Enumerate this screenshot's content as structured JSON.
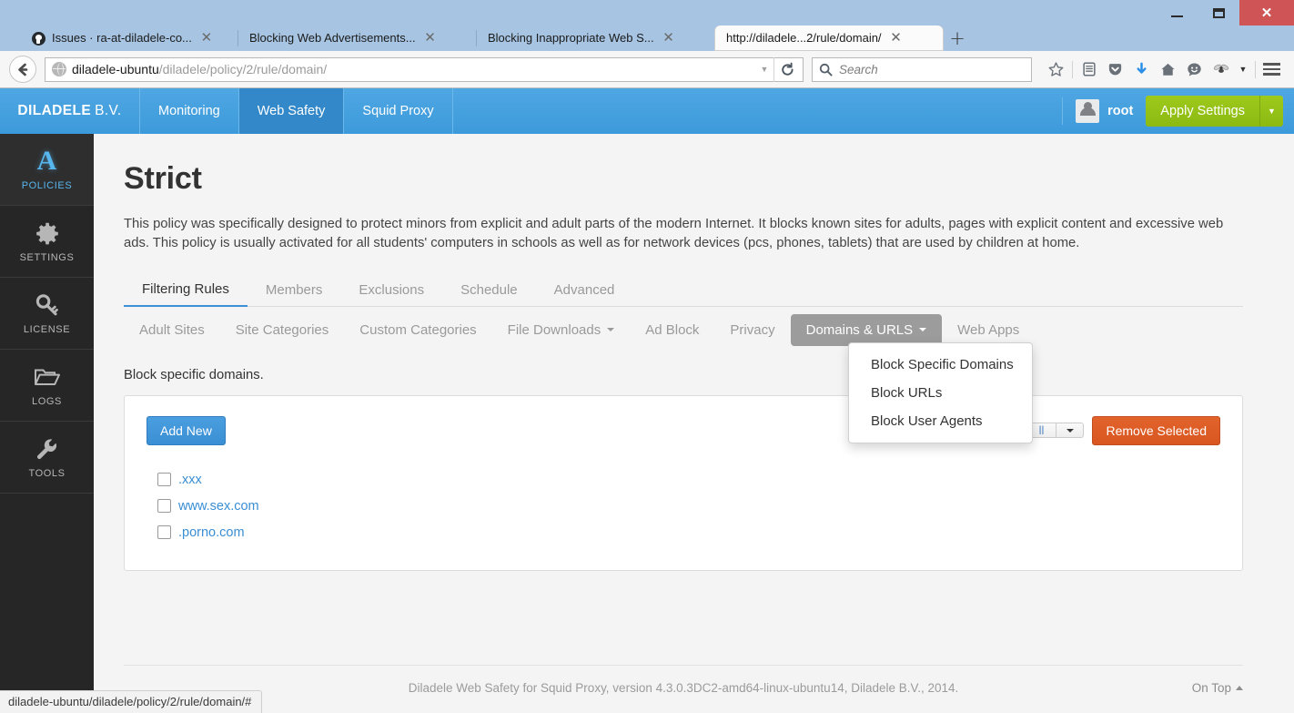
{
  "window": {
    "minimize_label": "Minimize",
    "maximize_label": "Maximize",
    "close_label": "✕"
  },
  "browser": {
    "tabs": [
      {
        "title": "Issues · ra-at-diladele-co...",
        "favicon": "github-icon",
        "active": false
      },
      {
        "title": "Blocking Web Advertisements...",
        "favicon": "none",
        "active": false
      },
      {
        "title": "Blocking Inappropriate Web S...",
        "favicon": "none",
        "active": false
      },
      {
        "title": "http://diladele...2/rule/domain/",
        "favicon": "none",
        "active": true
      }
    ],
    "new_tab_label": "+",
    "tab_close_label": "✕",
    "url_host": "diladele-ubuntu",
    "url_path": "/diladele/policy/2/rule/domain/",
    "search_placeholder": "Search",
    "toolbar_icons": [
      "bookmark-star-icon",
      "reading-list-icon",
      "pocket-icon",
      "downloads-icon",
      "home-icon",
      "feedback-smiley-icon",
      "fly-icon",
      "overflow-caret-icon",
      "menu-hamburger-icon"
    ]
  },
  "app": {
    "brand_bold": "DILADELE",
    "brand_light": "B.V.",
    "nav_items": [
      {
        "label": "Monitoring",
        "active": false
      },
      {
        "label": "Web Safety",
        "active": true
      },
      {
        "label": "Squid Proxy",
        "active": false
      }
    ],
    "username": "root",
    "apply_label": "Apply Settings",
    "apply_caret": "▼"
  },
  "sidebar": {
    "items": [
      {
        "label": "POLICIES",
        "icon": "letter-a-icon",
        "active": true
      },
      {
        "label": "SETTINGS",
        "icon": "gear-icon",
        "active": false
      },
      {
        "label": "LICENSE",
        "icon": "key-icon",
        "active": false
      },
      {
        "label": "LOGS",
        "icon": "folder-icon",
        "active": false
      },
      {
        "label": "TOOLS",
        "icon": "wrench-icon",
        "active": false
      }
    ]
  },
  "main": {
    "page_title": "Strict",
    "description": "This policy was specifically designed to protect minors from explicit and adult parts of the modern Internet. It blocks known sites for adults, pages with explicit content and excessive web ads. This policy is usually activated for all students' computers in schools as well as for network devices (pcs, phones, tablets) that are used by children at home.",
    "primary_tabs": [
      {
        "label": "Filtering Rules",
        "active": true
      },
      {
        "label": "Members",
        "active": false
      },
      {
        "label": "Exclusions",
        "active": false
      },
      {
        "label": "Schedule",
        "active": false
      },
      {
        "label": "Advanced",
        "active": false
      }
    ],
    "secondary_tabs": [
      {
        "label": "Adult Sites",
        "active": false,
        "has_caret": false
      },
      {
        "label": "Site Categories",
        "active": false,
        "has_caret": false
      },
      {
        "label": "Custom Categories",
        "active": false,
        "has_caret": false
      },
      {
        "label": "File Downloads",
        "active": false,
        "has_caret": true
      },
      {
        "label": "Ad Block",
        "active": false,
        "has_caret": false
      },
      {
        "label": "Privacy",
        "active": false,
        "has_caret": false
      },
      {
        "label": "Domains & URLS",
        "active": true,
        "has_caret": true
      },
      {
        "label": "Web Apps",
        "active": false,
        "has_caret": false
      }
    ],
    "dropdown_items": [
      "Block Specific Domains",
      "Block URLs",
      "Block User Agents"
    ],
    "section_note": "Block specific domains.",
    "add_new_label": "Add New",
    "remove_selected_label": "Remove Selected",
    "split_button_label": "ll",
    "split_caret_label": "▼",
    "domains": [
      ".xxx",
      "www.sex.com",
      ".porno.com"
    ]
  },
  "footer": {
    "text": "Diladele Web Safety for Squid Proxy, version 4.3.0.3DC2-amd64-linux-ubuntu14, Diladele B.V., 2014.",
    "on_top_label": "On Top"
  },
  "status_bar": {
    "text": "diladele-ubuntu/diladele/policy/2/rule/domain/#"
  },
  "colors": {
    "brand_blue": "#3d9ada",
    "accent_green": "#9ec91c",
    "accent_orange": "#d95621",
    "link_blue": "#3a8ed3",
    "sidebar_dark": "#262626",
    "active_tab_gray": "#9c9c9c"
  }
}
